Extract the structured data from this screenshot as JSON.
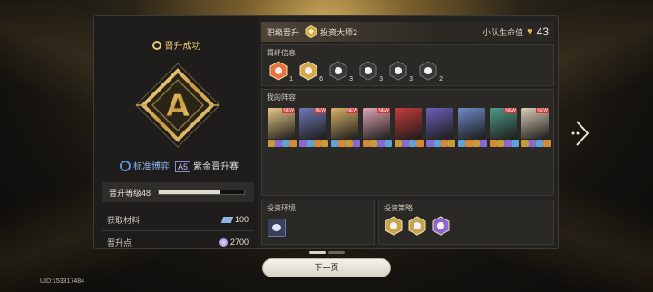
{
  "left": {
    "success_label": "晋升成功",
    "rank_letter": "A",
    "mode_name": "标准博弈",
    "tier_badge": "A5",
    "tier_name": "紫金晋升赛",
    "level_label": "晋升等级48",
    "level_progress": 0.72,
    "materials_label": "获取材料",
    "materials_value": "100",
    "points_label": "晋升点",
    "points_value": "2700"
  },
  "header": {
    "rank_up_label": "职级晋升",
    "rank_title": "投资大师2",
    "life_label": "小队生命值",
    "life_value": "43"
  },
  "bonds": {
    "title": "羁绊信息",
    "items": [
      {
        "icon": "flame-path-icon",
        "count": "1",
        "color": "#e9723c"
      },
      {
        "icon": "burst-icon",
        "count": "6",
        "color": "#d6a84a"
      },
      {
        "icon": "battery-icon",
        "count": "3",
        "color": "#888"
      },
      {
        "icon": "gear-bond-icon",
        "count": "3",
        "color": "#888"
      },
      {
        "icon": "cross-icon",
        "count": "3",
        "color": "#888"
      },
      {
        "icon": "spiral-icon",
        "count": "2",
        "color": "#888"
      }
    ]
  },
  "lineup": {
    "title": "我的阵容",
    "characters": [
      {
        "name": "character-1",
        "color": "#e9c98a",
        "new": true
      },
      {
        "name": "character-2",
        "color": "#6e79b8",
        "new": true
      },
      {
        "name": "character-3",
        "color": "#d8b36a",
        "new": true
      },
      {
        "name": "character-4",
        "color": "#e2a6b6",
        "new": true
      },
      {
        "name": "character-5",
        "color": "#c63b3b",
        "new": false
      },
      {
        "name": "character-6",
        "color": "#6b5fbd",
        "new": false
      },
      {
        "name": "character-7",
        "color": "#6c8bc7",
        "new": false
      },
      {
        "name": "character-8",
        "color": "#4f9c8a",
        "new": true
      },
      {
        "name": "character-9",
        "color": "#d9cdb6",
        "new": true
      }
    ],
    "new_tag": "NEW"
  },
  "environment": {
    "title": "投资环境"
  },
  "strategy": {
    "title": "投资策略",
    "items": [
      {
        "icon": "strategy-coin-icon",
        "color": "#c9a44e"
      },
      {
        "icon": "strategy-card-icon",
        "color": "#c9a44e"
      },
      {
        "icon": "strategy-triangle-icon",
        "color": "#8a68d0"
      }
    ]
  },
  "footer": {
    "next_label": "下一页",
    "uid": "UID:153317484"
  },
  "colors": {
    "gold": "#e6c67a",
    "blue": "#8eb3ef",
    "purple": "#8e88d8"
  }
}
